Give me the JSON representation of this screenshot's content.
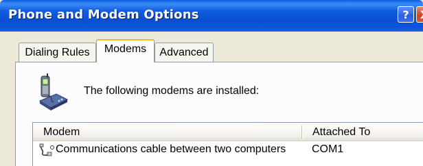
{
  "window": {
    "title": "Phone and Modem Options",
    "help_glyph": "?",
    "close_glyph": "X"
  },
  "tabs": [
    {
      "label": "Dialing Rules",
      "selected": false
    },
    {
      "label": "Modems",
      "selected": true
    },
    {
      "label": "Advanced",
      "selected": false
    }
  ],
  "modems_tab": {
    "intro_text": "The following modems are  installed:",
    "icon": "phone-modem-icon",
    "columns": [
      "Modem",
      "Attached To"
    ],
    "rows": [
      {
        "icon": "null-modem-cable-icon",
        "modem": "Communications cable between two computers",
        "attached_to": "COM1"
      }
    ]
  },
  "colors": {
    "titlebar": "#0a4fd0",
    "dialog_bg": "#ece9d8",
    "tab_highlight": "#f3b43a"
  }
}
